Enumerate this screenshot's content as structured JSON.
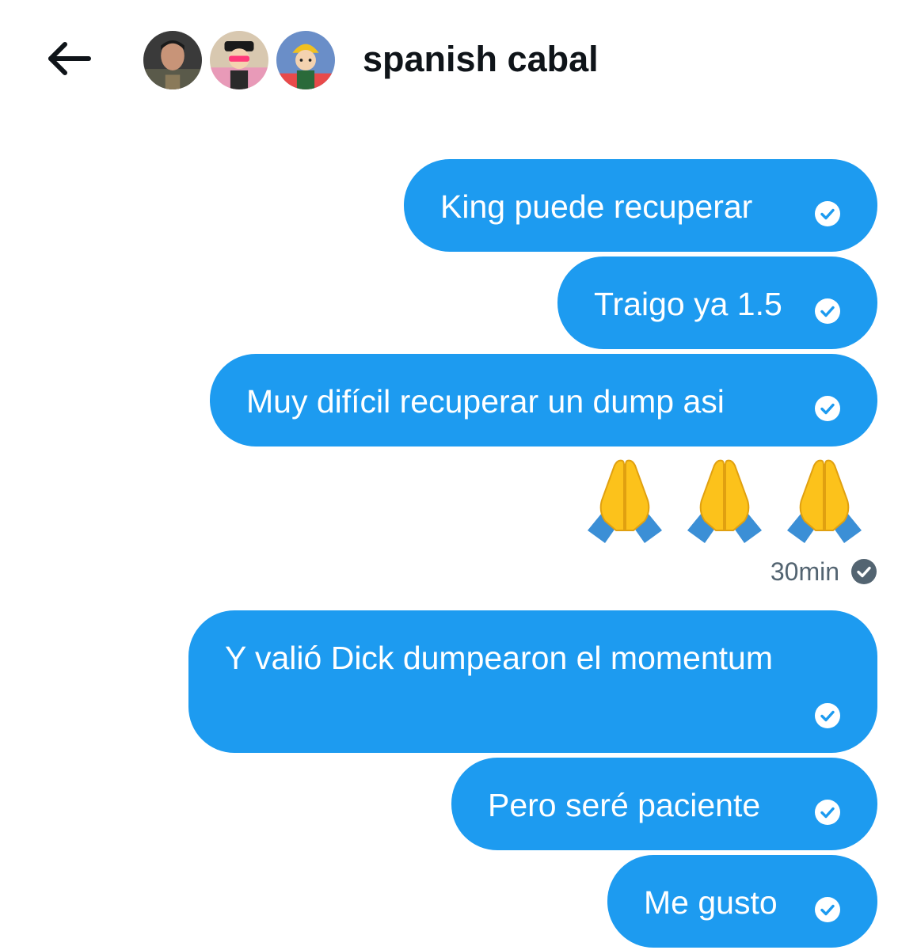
{
  "header": {
    "back_icon": "arrow-left-icon",
    "title": "spanish cabal",
    "avatars": [
      "member-avatar-man",
      "member-avatar-cartoon-cap",
      "member-avatar-cartoon-helmet"
    ]
  },
  "messages": [
    {
      "text": "King puede recuperar",
      "status_icon": "check-circle-icon"
    },
    {
      "text": "Traigo ya 1.5",
      "status_icon": "check-circle-icon"
    },
    {
      "text": "Muy difícil recuperar un dump asi",
      "status_icon": "check-circle-icon"
    },
    {
      "emoji": [
        "folded-hands",
        "folded-hands",
        "folded-hands"
      ],
      "timestamp": "30min",
      "status_icon": "check-circle-filled-icon"
    },
    {
      "text": "Y valió Dick dumpearon el momentum",
      "status_icon": "check-circle-icon"
    },
    {
      "text": "Pero seré paciente",
      "status_icon": "check-circle-icon"
    },
    {
      "text": "Me gusto",
      "status_icon": "check-circle-icon"
    }
  ],
  "colors": {
    "bubble": "#1d9bf0",
    "bubble_text": "#ffffff",
    "title": "#0f1419",
    "timestamp": "#536471"
  }
}
